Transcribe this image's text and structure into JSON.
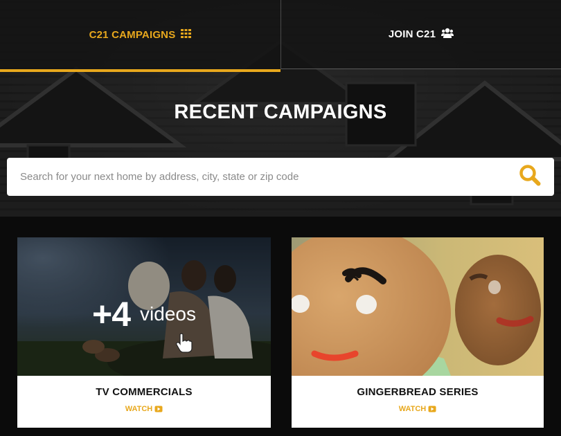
{
  "nav": {
    "tabs": [
      {
        "label": "C21 CAMPAIGNS",
        "icon": "grid-icon",
        "active": true
      },
      {
        "label": "JOIN C21",
        "icon": "users-icon",
        "active": false
      }
    ]
  },
  "hero": {
    "title": "RECENT CAMPAIGNS"
  },
  "search": {
    "placeholder": "Search for your next home by address, city, state or zip code",
    "icon": "search-icon"
  },
  "cards": [
    {
      "title": "TV COMMERCIALS",
      "watch_label": "WATCH",
      "overlay_count": "+4",
      "overlay_word": "videos"
    },
    {
      "title": "GINGERBREAD SERIES",
      "watch_label": "WATCH"
    }
  ],
  "colors": {
    "accent": "#e8a81d",
    "nav_bg": "#141414",
    "page_bg": "#0b0b0b",
    "card_bg": "#ffffff"
  }
}
